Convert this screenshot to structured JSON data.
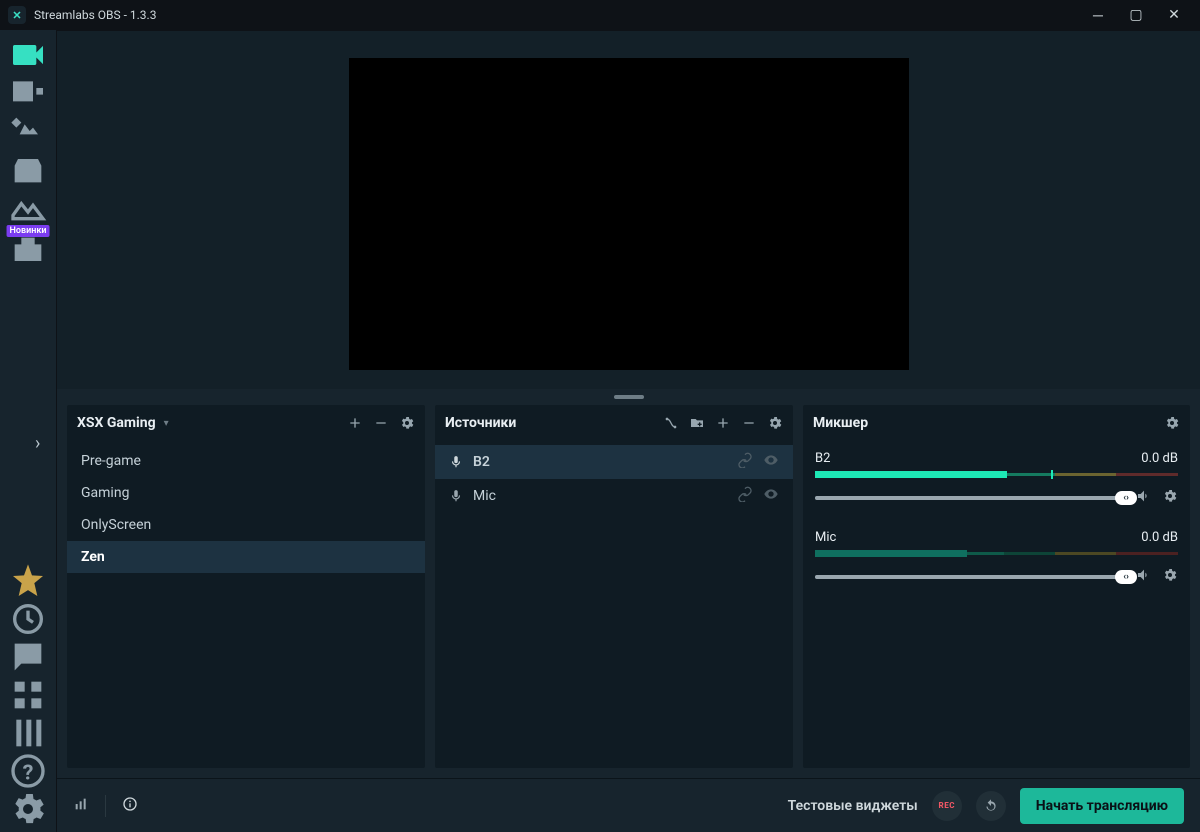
{
  "window": {
    "title": "Streamlabs OBS - 1.3.3"
  },
  "sidebar": {
    "badge": "Новинки"
  },
  "scenes": {
    "collection": "XSX Gaming",
    "items": [
      {
        "label": "Pre-game"
      },
      {
        "label": "Gaming"
      },
      {
        "label": "OnlyScreen"
      },
      {
        "label": "Zen",
        "selected": true
      }
    ]
  },
  "sources": {
    "title": "Источники",
    "items": [
      {
        "label": "B2",
        "selected": true
      },
      {
        "label": "Mic"
      }
    ]
  },
  "mixer": {
    "title": "Микшер",
    "channels": [
      {
        "name": "B2",
        "db": "0.0 dB"
      },
      {
        "name": "Mic",
        "db": "0.0 dB"
      }
    ]
  },
  "bottom": {
    "test_widgets": "Тестовые виджеты",
    "rec_label": "REC",
    "go_live": "Начать трансляцию"
  }
}
